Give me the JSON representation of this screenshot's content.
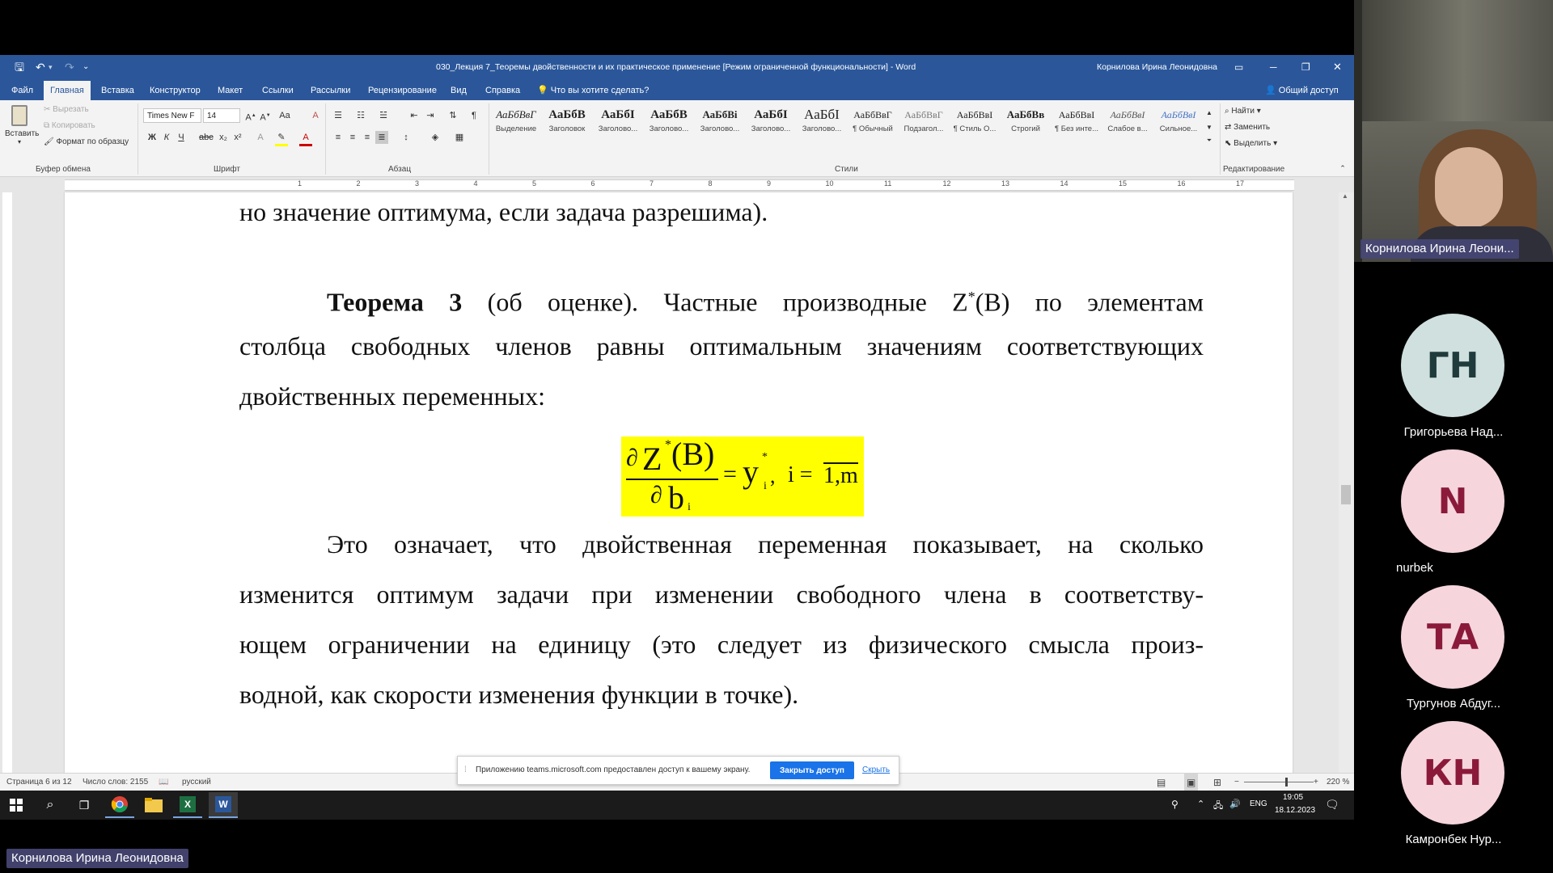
{
  "word": {
    "document_title": "030_Лекция 7_Теоремы двойственности и их практическое применение [Режим ограниченной функциональности]  -  Word",
    "user_name": "Корнилова Ирина Леонидовна",
    "tabs": [
      "Файл",
      "Главная",
      "Вставка",
      "Конструктор",
      "Макет",
      "Ссылки",
      "Рассылки",
      "Рецензирование",
      "Вид",
      "Справка"
    ],
    "tell_me": "Что вы хотите сделать?",
    "share": "Общий доступ",
    "clipboard": {
      "paste": "Вставить",
      "cut": "Вырезать",
      "copy": "Копировать",
      "format_painter": "Формат по образцу",
      "label": "Буфер обмена"
    },
    "font": {
      "name": "Times New F",
      "size": "14",
      "label": "Шрифт"
    },
    "paragraph_label": "Абзац",
    "styles": [
      {
        "sample": "АаБбВвГ",
        "name": "Выделение"
      },
      {
        "sample": "АаБбВ",
        "name": "Заголовок"
      },
      {
        "sample": "АаБбI",
        "name": "Заголово..."
      },
      {
        "sample": "АаБбВ",
        "name": "Заголово..."
      },
      {
        "sample": "АаБбВі",
        "name": "Заголово..."
      },
      {
        "sample": "АаБбI",
        "name": "Заголово..."
      },
      {
        "sample": "АаБбI",
        "name": "Заголово..."
      },
      {
        "sample": "АаБбВвГ",
        "name": "¶ Обычный"
      },
      {
        "sample": "АаБбВвГ",
        "name": "Подзагол..."
      },
      {
        "sample": "АаБбВвI",
        "name": "¶ Стиль О..."
      },
      {
        "sample": "АаБбВв",
        "name": "Строгий"
      },
      {
        "sample": "АаБбВвI",
        "name": "¶ Без инте..."
      },
      {
        "sample": "АаБбВвI",
        "name": "Слабое в..."
      },
      {
        "sample": "АаБбВвI",
        "name": "Сильное..."
      }
    ],
    "styles_label": "Стили",
    "editing": {
      "find": "Найти",
      "replace": "Заменить",
      "select": "Выделить",
      "label": "Редактирование"
    },
    "ruler_numbers": [
      "1",
      "2",
      "3",
      "4",
      "5",
      "6",
      "7",
      "8",
      "9",
      "10",
      "11",
      "12",
      "13",
      "14",
      "15",
      "16",
      "17"
    ],
    "doc": {
      "line0": "но значение оптимума, если задача разрешима).",
      "theorem_bold": "Теорема 3",
      "theorem_line1_rest": " (об оценке). Частные производные Z",
      "theorem_sup": "*",
      "theorem_line1_end": "(B) по элементам",
      "theorem_line2": "столбца свободных членов равны оптимальным значениям соответствующих",
      "theorem_line3": "двойственных переменных:",
      "formula": {
        "partial": "∂",
        "Z": "Z",
        "star": "*",
        "B": "(B)",
        "b": "b",
        "i": "i",
        "equals": "=",
        "y": "y",
        "comma": ",",
        "index_eq": "i = ",
        "range": "1,m"
      },
      "para2_line1": "Это означает, что двойственная переменная показывает, на сколько",
      "para2_line2": "изменится оптимум задачи при изменении свободного члена в соответству-",
      "para2_line3": "ющем ограничении на единицу (это следует из физического смысла произ-",
      "para2_line4": "водной, как скорости изменения функции в точке)."
    },
    "status": {
      "page": "Страница 6 из 12",
      "words": "Число слов: 2155",
      "language": "русский",
      "zoom": "220 %"
    }
  },
  "share_bar": {
    "message": "Приложению teams.microsoft.com предоставлен доступ к вашему экрану.",
    "stop_button": "Закрыть доступ",
    "hide_link": "Скрыть"
  },
  "taskbar": {
    "lang": "ENG",
    "time": "19:05",
    "date": "18.12.2023"
  },
  "teams": {
    "presenter_tag": "Корнилова Ирина Леони...",
    "bottom_tag": "Корнилова Ирина Леонидовна",
    "participants": [
      {
        "initials": "ГН",
        "name": "Григорьева Над...",
        "bg": "#cfe0df",
        "fg": "#1f3b3b"
      },
      {
        "initials": "N",
        "name": "nurbek",
        "bg": "#f6d5dc",
        "fg": "#8b1a3a"
      },
      {
        "initials": "ТА",
        "name": "Тургунов Абдуг...",
        "bg": "#f6d5dc",
        "fg": "#8b1a3a"
      },
      {
        "initials": "КН",
        "name": "Камронбек Нур...",
        "bg": "#f6d5dc",
        "fg": "#8b1a3a"
      }
    ]
  }
}
